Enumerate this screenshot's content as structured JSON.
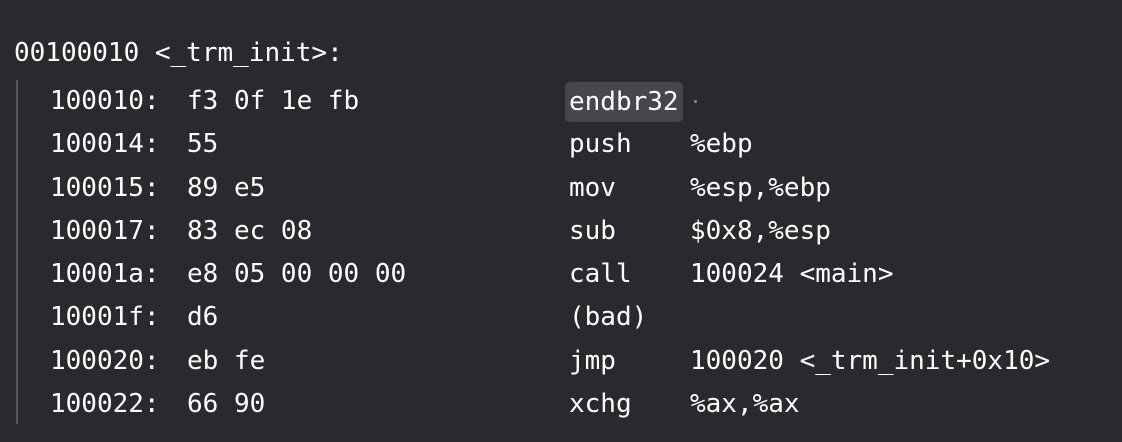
{
  "function_header": "00100010 <_trm_init>:",
  "instructions": [
    {
      "address": "100010:",
      "bytes": "f3 0f 1e fb",
      "mnemonic": "endbr32",
      "operands": ""
    },
    {
      "address": "100014:",
      "bytes": "55",
      "mnemonic": "push",
      "operands": "%ebp"
    },
    {
      "address": "100015:",
      "bytes": "89 e5",
      "mnemonic": "mov",
      "operands": "%esp,%ebp"
    },
    {
      "address": "100017:",
      "bytes": "83 ec 08",
      "mnemonic": "sub",
      "operands": "$0x8,%esp"
    },
    {
      "address": "10001a:",
      "bytes": "e8 05 00 00 00",
      "mnemonic": "call",
      "operands": "100024 <main>"
    },
    {
      "address": "10001f:",
      "bytes": "d6",
      "mnemonic": "(bad)",
      "operands": ""
    },
    {
      "address": "100020:",
      "bytes": "eb fe",
      "mnemonic": "jmp",
      "operands": "100020 <_trm_init+0x10>"
    },
    {
      "address": "100022:",
      "bytes": "66 90",
      "mnemonic": "xchg",
      "operands": "%ax,%ax"
    }
  ],
  "colors": {
    "background": "#2b292e",
    "text": "#ffffff",
    "highlight": "#48464c",
    "gutter": "#5a585d"
  }
}
